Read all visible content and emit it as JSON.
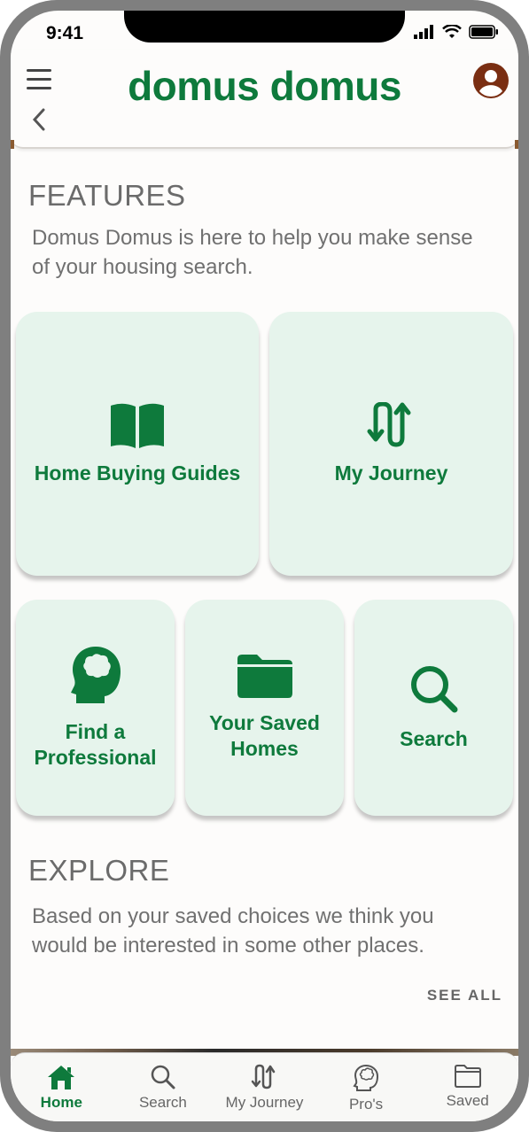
{
  "status": {
    "time": "9:41"
  },
  "header": {
    "logo": "domus domus"
  },
  "features": {
    "title": "FEATURES",
    "description": "Domus Domus is here to help you make sense of your housing search.",
    "cards": [
      {
        "label": "Home Buying Guides",
        "icon": "book-icon"
      },
      {
        "label": "My Journey",
        "icon": "journey-arrows-icon"
      },
      {
        "label": "Find a Professional",
        "icon": "head-brain-icon"
      },
      {
        "label": "Your Saved Homes",
        "icon": "folder-icon"
      },
      {
        "label": "Search",
        "icon": "search-icon"
      }
    ]
  },
  "explore": {
    "title": "EXPLORE",
    "description": "Based on your saved choices we think you would be interested in some other places.",
    "see_all": "SEE ALL"
  },
  "tabbar": {
    "items": [
      {
        "label": "Home",
        "icon": "home-icon",
        "active": true
      },
      {
        "label": "Search",
        "icon": "search-icon"
      },
      {
        "label": "My Journey",
        "icon": "journey-arrows-icon"
      },
      {
        "label": "Pro's",
        "icon": "head-brain-icon"
      },
      {
        "label": "Saved",
        "icon": "folder-icon"
      }
    ]
  },
  "colors": {
    "brand": "#0e7a3c",
    "card_bg": "#e6f4ec",
    "text_muted": "#6b6b6b"
  }
}
